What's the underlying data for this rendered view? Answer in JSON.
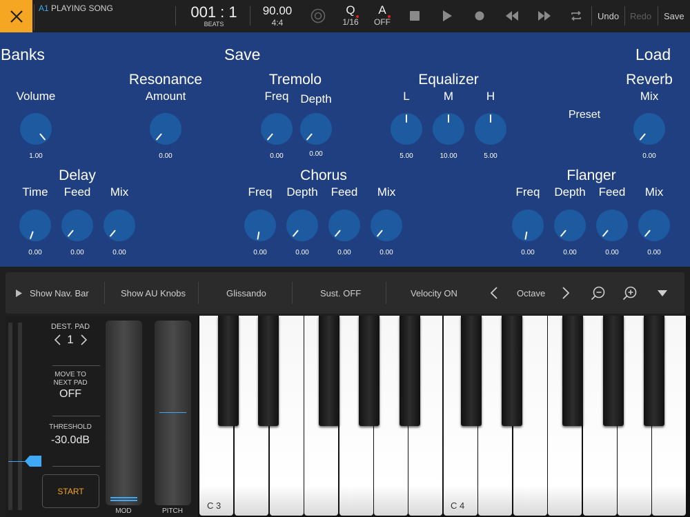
{
  "topbar": {
    "track_id": "A1",
    "status": "PLAYING SONG",
    "position": "001 : 1",
    "position_unit": "BEATS",
    "tempo": "90.00",
    "time_signature": "4:4",
    "quantize_label": "Q",
    "quantize_value": "1/16",
    "auto_label": "A",
    "auto_value": "OFF",
    "undo": "Undo",
    "redo": "Redo",
    "save": "Save"
  },
  "fx": {
    "banks": "Banks",
    "save": "Save",
    "load": "Load",
    "preset": "Preset",
    "volume": {
      "label": "Volume",
      "value": "1.00"
    },
    "resonance": {
      "title": "Resonance",
      "label": "Amount",
      "value": "0.00"
    },
    "tremolo": {
      "title": "Tremolo",
      "freq_label": "Freq",
      "freq_value": "0.00",
      "depth_label": "Depth",
      "depth_value": "0.00"
    },
    "equalizer": {
      "title": "Equalizer",
      "l_label": "L",
      "l_value": "5.00",
      "m_label": "M",
      "m_value": "10.00",
      "h_label": "H",
      "h_value": "5.00"
    },
    "reverb": {
      "title": "Reverb",
      "mix_label": "Mix",
      "mix_value": "0.00"
    },
    "delay": {
      "title": "Delay",
      "time_label": "Time",
      "time_value": "0.00",
      "feed_label": "Feed",
      "feed_value": "0.00",
      "mix_label": "Mix",
      "mix_value": "0.00"
    },
    "chorus": {
      "title": "Chorus",
      "freq_label": "Freq",
      "freq_value": "0.00",
      "depth_label": "Depth",
      "depth_value": "0.00",
      "feed_label": "Feed",
      "feed_value": "0.00",
      "mix_label": "Mix",
      "mix_value": "0.00"
    },
    "flanger": {
      "title": "Flanger",
      "freq_label": "Freq",
      "freq_value": "0.00",
      "depth_label": "Depth",
      "depth_value": "0.00",
      "feed_label": "Feed",
      "feed_value": "0.00",
      "mix_label": "Mix",
      "mix_value": "0.00"
    }
  },
  "kbtoolbar": {
    "show_nav": "Show Nav. Bar",
    "show_au": "Show AU Knobs",
    "glissando": "Glissando",
    "sustain": "Sust. OFF",
    "velocity": "Velocity ON",
    "octave": "Octave"
  },
  "leftctl": {
    "dest_pad_label": "DEST. PAD",
    "dest_pad_value": "1",
    "move_label_1": "MOVE TO",
    "move_label_2": "NEXT PAD",
    "move_value": "OFF",
    "threshold_label": "THRESHOLD",
    "threshold_value": "-30.0dB",
    "start": "START",
    "mod": "MOD",
    "pitch": "PITCH"
  },
  "piano": {
    "c3": "C 3",
    "c4": "C 4"
  },
  "colors": {
    "accent": "#f5a623",
    "panel": "#1f3f80",
    "knob": "#1e5aa0",
    "highlight": "#3fa9f5",
    "record_dot": "#e02020"
  }
}
